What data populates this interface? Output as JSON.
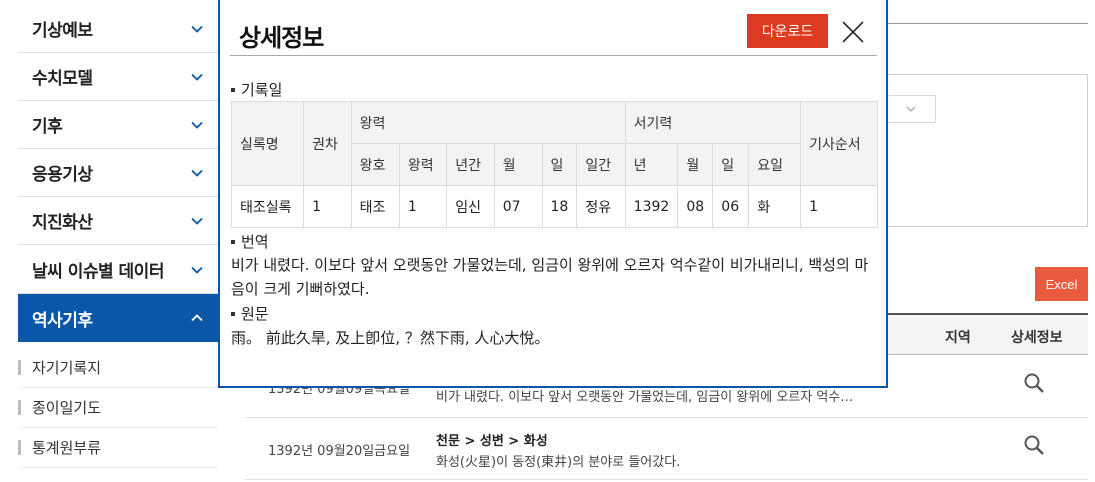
{
  "sidebar": {
    "items": [
      {
        "label": "기상예보"
      },
      {
        "label": "수치모델"
      },
      {
        "label": "기후"
      },
      {
        "label": "응용기상"
      },
      {
        "label": "지진화산"
      },
      {
        "label": "날씨 이슈별 데이터"
      },
      {
        "label": "역사기후"
      }
    ],
    "subitems": [
      {
        "label": "자기기록지"
      },
      {
        "label": "종이일기도"
      },
      {
        "label": "통계원부류"
      }
    ]
  },
  "background": {
    "excel_label": "Excel",
    "table_headers": {
      "region": "지역",
      "detail": "상세정보"
    },
    "rows": [
      {
        "date": "1392년 09월09일목요일",
        "category": "",
        "text": "비가 내렸다. 이보다 앞서 오랫동안 가물었는데, 임금이 왕위에 오르자 억수…"
      },
      {
        "date": "1392년 09월20일금요일",
        "category": "천문 > 성변 > 화성",
        "text": "화성(火星)이 동정(東井)의 분야로 들어갔다."
      }
    ]
  },
  "modal": {
    "title": "상세정보",
    "download_label": "다운로드",
    "record_date_label": "기록일",
    "table": {
      "headers": {
        "sillok": "실록명",
        "volume": "권차",
        "wangryeok": "왕력",
        "seogiryeok": "서기력",
        "order": "기사순서",
        "wangho": "왕호",
        "wangryeok_sub": "왕력",
        "nyeongan": "년간",
        "month": "월",
        "day": "일",
        "ilgan": "일간",
        "year": "년",
        "s_month": "월",
        "s_day": "일",
        "weekday": "요일"
      },
      "row": {
        "sillok": "태조실록",
        "volume": "1",
        "wangho": "태조",
        "wangryeok": "1",
        "nyeongan": "임신",
        "month": "07",
        "day": "18",
        "ilgan": "정유",
        "year": "1392",
        "s_month": "08",
        "s_day": "06",
        "weekday": "화",
        "order": "1"
      }
    },
    "translation_label": "번역",
    "translation_text": "비가 내렸다. 이보다 앞서 오랫동안 가물었는데, 임금이 왕위에 오르자 억수같이 비가내리니, 백성의 마음이 크게 기뻐하였다.",
    "original_label": "원문",
    "original_text": "雨。 前此久旱, 及上卽位, ？然下雨, 人心大悅。"
  },
  "colors": {
    "accent": "#0a56a8",
    "download": "#dc3b1f",
    "excel": "#ea5a3d"
  },
  "icons": [
    "chevron-down-icon",
    "chevron-up-icon",
    "close-icon",
    "search-icon"
  ]
}
